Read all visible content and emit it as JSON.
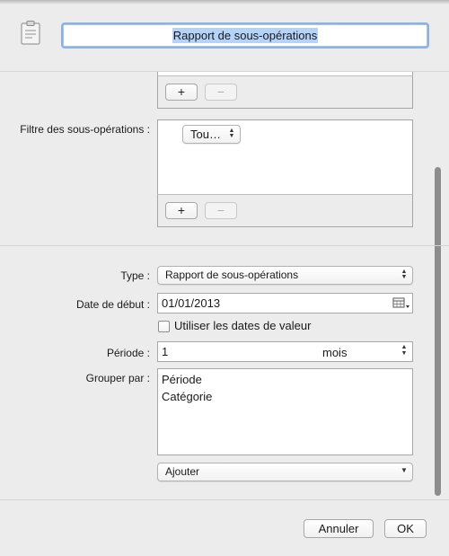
{
  "header": {
    "title_value": "Rapport de sous-opérations",
    "icon": "clipboard-icon"
  },
  "list_top": {
    "add_label": "+",
    "remove_label": "−"
  },
  "filter": {
    "label": "Filtre des sous-opérations :",
    "token_value": "Tou…",
    "add_label": "+",
    "remove_label": "−"
  },
  "form": {
    "type_label": "Type :",
    "type_value": "Rapport de sous-opérations",
    "start_date_label": "Date de début :",
    "start_date_value": "01/01/2013",
    "calendar_icon": "calendar-icon",
    "use_value_dates_label": "Utiliser les dates de valeur",
    "use_value_dates_checked": false,
    "period_label": "Période :",
    "period_value": "1",
    "period_unit": "mois",
    "group_by_label": "Grouper par :",
    "group_by_items": [
      "Période",
      "Catégorie"
    ],
    "add_group_value": "Ajouter"
  },
  "footer": {
    "cancel_label": "Annuler",
    "ok_label": "OK"
  }
}
